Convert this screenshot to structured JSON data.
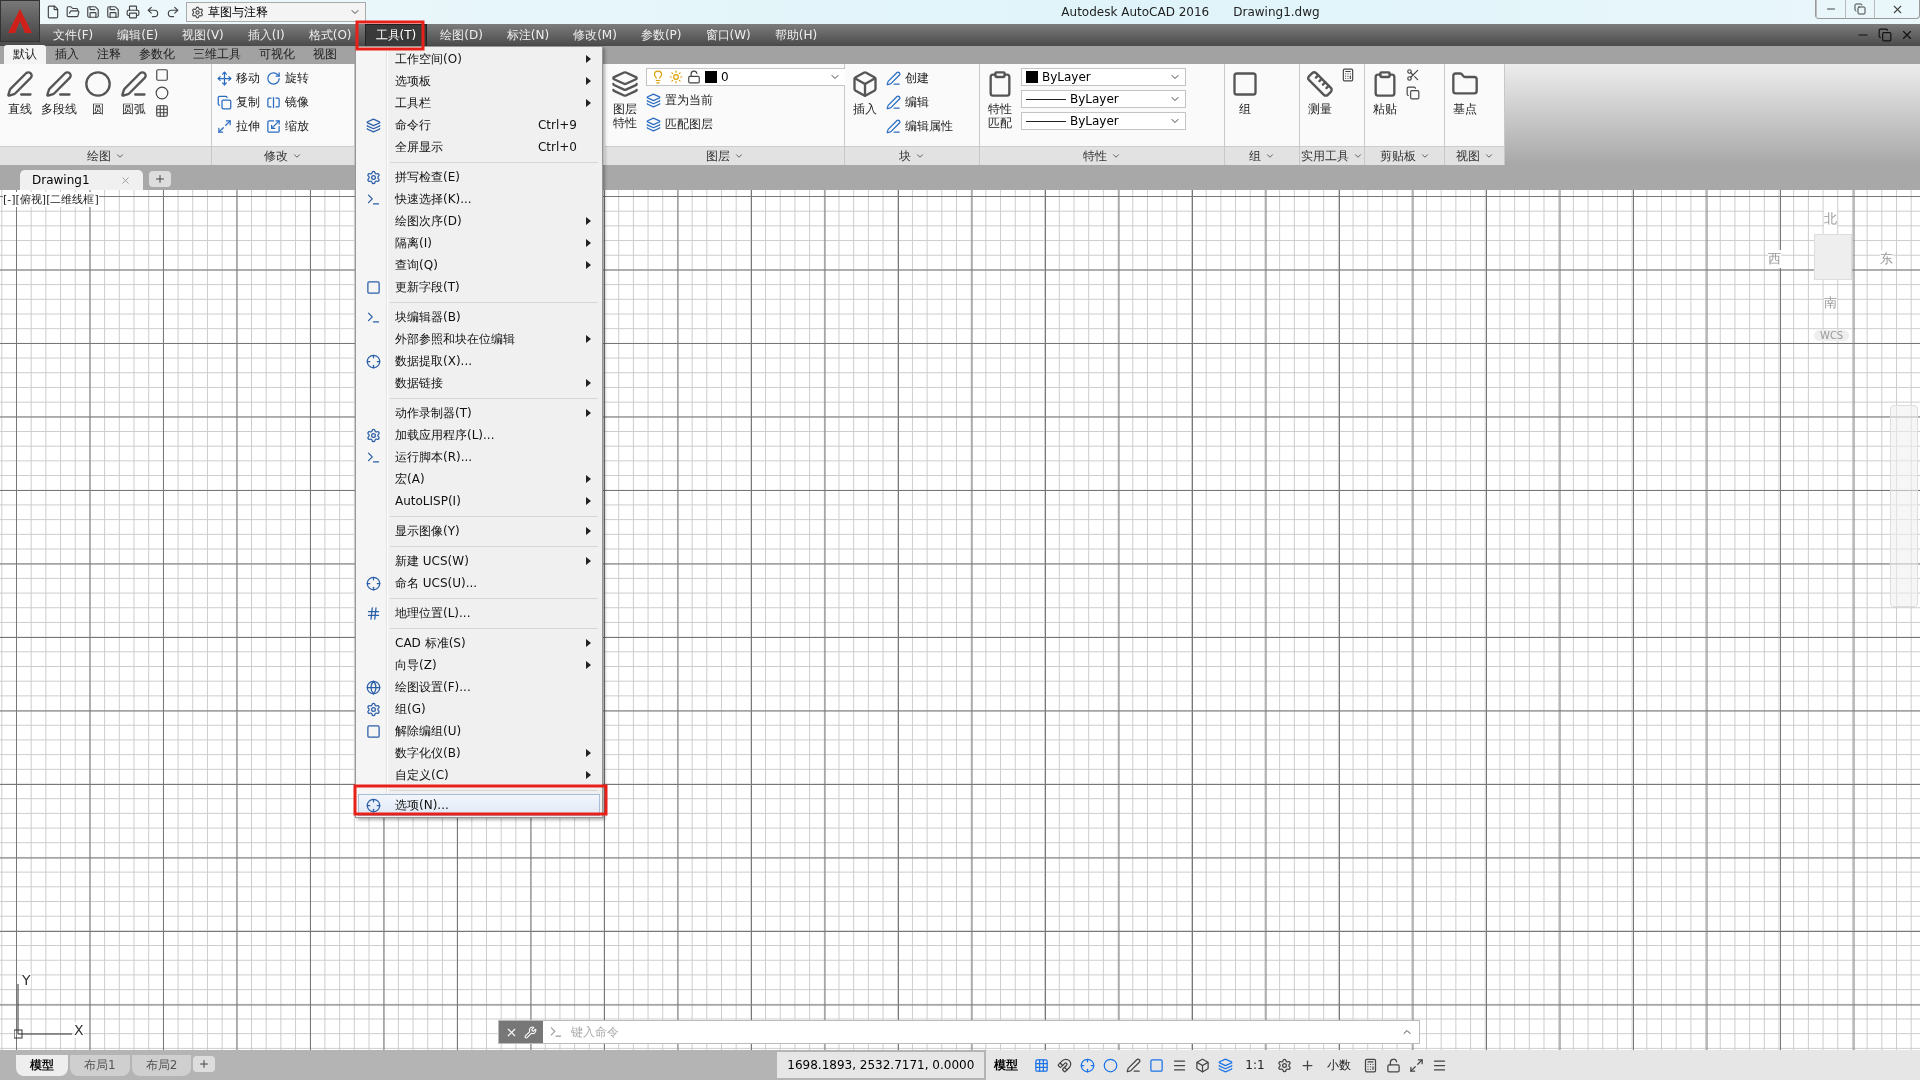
{
  "titlebar": {
    "workspace": "草图与注释",
    "app_name": "Autodesk AutoCAD 2016",
    "document": "Drawing1.dwg"
  },
  "menubar": [
    {
      "label": "文件(F)",
      "selected": false
    },
    {
      "label": "编辑(E)",
      "selected": false
    },
    {
      "label": "视图(V)",
      "selected": false
    },
    {
      "label": "插入(I)",
      "selected": false
    },
    {
      "label": "格式(O)",
      "selected": false
    },
    {
      "label": "工具(T)",
      "selected": true
    },
    {
      "label": "绘图(D)",
      "selected": false
    },
    {
      "label": "标注(N)",
      "selected": false
    },
    {
      "label": "修改(M)",
      "selected": false
    },
    {
      "label": "参数(P)",
      "selected": false
    },
    {
      "label": "窗口(W)",
      "selected": false
    },
    {
      "label": "帮助(H)",
      "selected": false
    }
  ],
  "ribbon": {
    "tabs": [
      {
        "label": "默认",
        "selected": true
      },
      {
        "label": "插入",
        "selected": false
      },
      {
        "label": "注释",
        "selected": false
      },
      {
        "label": "参数化",
        "selected": false
      },
      {
        "label": "三维工具",
        "selected": false
      },
      {
        "label": "可视化",
        "selected": false
      },
      {
        "label": "视图",
        "selected": false
      }
    ],
    "panels": [
      {
        "kind": "draw",
        "title": "绘图",
        "large": [
          "直线",
          "多段线",
          "圆",
          "圆弧"
        ]
      },
      {
        "kind": "modify",
        "title": "修改",
        "small": [
          "移动",
          "旋转",
          "复制",
          "镜像",
          "拉伸",
          "缩放"
        ]
      },
      {
        "kind": "layers",
        "title": "图层",
        "large": [
          "图层特性"
        ],
        "layer": "0",
        "small": [
          "置为当前",
          "匹配图层"
        ]
      },
      {
        "kind": "block",
        "title": "块",
        "large": [
          "插入"
        ],
        "small": [
          "创建",
          "编辑",
          "编辑属性"
        ]
      },
      {
        "kind": "properties",
        "title": "特性",
        "large": [
          "特性匹配"
        ],
        "dropdowns": [
          "ByLayer",
          "ByLayer",
          "ByLayer"
        ]
      },
      {
        "kind": "group",
        "title": "组",
        "large": [
          "组"
        ]
      },
      {
        "kind": "utilities",
        "title": "实用工具",
        "large": [
          "测量"
        ]
      },
      {
        "kind": "clipboard",
        "title": "剪贴板",
        "large": [
          "粘贴"
        ]
      },
      {
        "kind": "view",
        "title": "视图",
        "large": [
          "基点"
        ]
      }
    ]
  },
  "tools_menu": {
    "items": [
      {
        "kind": "item",
        "label": "工作空间(O)",
        "submenu": true,
        "icon": false,
        "selected": false
      },
      {
        "kind": "item",
        "label": "选项板",
        "submenu": true,
        "icon": false,
        "selected": false
      },
      {
        "kind": "item",
        "label": "工具栏",
        "submenu": true,
        "icon": false,
        "selected": false
      },
      {
        "kind": "item",
        "label": "命令行",
        "shortcut": "Ctrl+9",
        "submenu": false,
        "icon": true,
        "selected": false
      },
      {
        "kind": "item",
        "label": "全屏显示",
        "shortcut": "Ctrl+0",
        "submenu": false,
        "icon": false,
        "selected": false
      },
      {
        "kind": "separator"
      },
      {
        "kind": "item",
        "label": "拼写检查(E)",
        "submenu": false,
        "icon": true,
        "selected": false
      },
      {
        "kind": "item",
        "label": "快速选择(K)...",
        "submenu": false,
        "icon": true,
        "selected": false
      },
      {
        "kind": "item",
        "label": "绘图次序(D)",
        "submenu": true,
        "icon": false,
        "selected": false
      },
      {
        "kind": "item",
        "label": "隔离(I)",
        "submenu": true,
        "icon": false,
        "selected": false
      },
      {
        "kind": "item",
        "label": "查询(Q)",
        "submenu": true,
        "icon": false,
        "selected": false
      },
      {
        "kind": "item",
        "label": "更新字段(T)",
        "submenu": false,
        "icon": true,
        "selected": false
      },
      {
        "kind": "separator"
      },
      {
        "kind": "item",
        "label": "块编辑器(B)",
        "submenu": false,
        "icon": true,
        "selected": false
      },
      {
        "kind": "item",
        "label": "外部参照和块在位编辑",
        "submenu": true,
        "icon": false,
        "selected": false
      },
      {
        "kind": "item",
        "label": "数据提取(X)...",
        "submenu": false,
        "icon": true,
        "selected": false
      },
      {
        "kind": "item",
        "label": "数据链接",
        "submenu": true,
        "icon": false,
        "selected": false
      },
      {
        "kind": "separator"
      },
      {
        "kind": "item",
        "label": "动作录制器(T)",
        "submenu": true,
        "icon": false,
        "selected": false
      },
      {
        "kind": "item",
        "label": "加载应用程序(L)...",
        "submenu": false,
        "icon": true,
        "selected": false
      },
      {
        "kind": "item",
        "label": "运行脚本(R)...",
        "submenu": false,
        "icon": true,
        "selected": false
      },
      {
        "kind": "item",
        "label": "宏(A)",
        "submenu": true,
        "icon": false,
        "selected": false
      },
      {
        "kind": "item",
        "label": "AutoLISP(I)",
        "submenu": true,
        "icon": false,
        "selected": false
      },
      {
        "kind": "separator"
      },
      {
        "kind": "item",
        "label": "显示图像(Y)",
        "submenu": true,
        "icon": false,
        "selected": false
      },
      {
        "kind": "separator"
      },
      {
        "kind": "item",
        "label": "新建 UCS(W)",
        "submenu": true,
        "icon": false,
        "selected": false
      },
      {
        "kind": "item",
        "label": "命名 UCS(U)...",
        "submenu": false,
        "icon": true,
        "selected": false
      },
      {
        "kind": "separator"
      },
      {
        "kind": "item",
        "label": "地理位置(L)...",
        "submenu": false,
        "icon": true,
        "selected": false
      },
      {
        "kind": "separator"
      },
      {
        "kind": "item",
        "label": "CAD 标准(S)",
        "submenu": true,
        "icon": false,
        "selected": false
      },
      {
        "kind": "item",
        "label": "向导(Z)",
        "submenu": true,
        "icon": false,
        "selected": false
      },
      {
        "kind": "item",
        "label": "绘图设置(F)...",
        "submenu": false,
        "icon": true,
        "selected": false
      },
      {
        "kind": "item",
        "label": "组(G)",
        "submenu": false,
        "icon": true,
        "selected": false
      },
      {
        "kind": "item",
        "label": "解除编组(U)",
        "submenu": false,
        "icon": true,
        "selected": false
      },
      {
        "kind": "item",
        "label": "数字化仪(B)",
        "submenu": true,
        "icon": false,
        "selected": false
      },
      {
        "kind": "item",
        "label": "自定义(C)",
        "submenu": true,
        "icon": false,
        "selected": false
      },
      {
        "kind": "separator"
      },
      {
        "kind": "item",
        "label": "选项(N)...",
        "submenu": false,
        "icon": true,
        "selected": true
      }
    ]
  },
  "document_tabs": [
    {
      "label": "Drawing1",
      "selected": true
    }
  ],
  "viewport_label": "[-][俯视][二维线框]",
  "viewcube": {
    "north": "北",
    "west": "西",
    "east": "东",
    "south": "南",
    "ucs": "WCS"
  },
  "ucs_icon": {
    "y": "Y",
    "x": "X"
  },
  "command_line": {
    "placeholder": "键入命令"
  },
  "layout_tabs": [
    {
      "label": "模型",
      "selected": true
    },
    {
      "label": "布局1",
      "selected": false
    },
    {
      "label": "布局2",
      "selected": false
    }
  ],
  "status_bar": {
    "coordinates": "1698.1893, 2532.7171, 0.0000",
    "space": "模型",
    "scale": "1:1",
    "units": "小数"
  }
}
